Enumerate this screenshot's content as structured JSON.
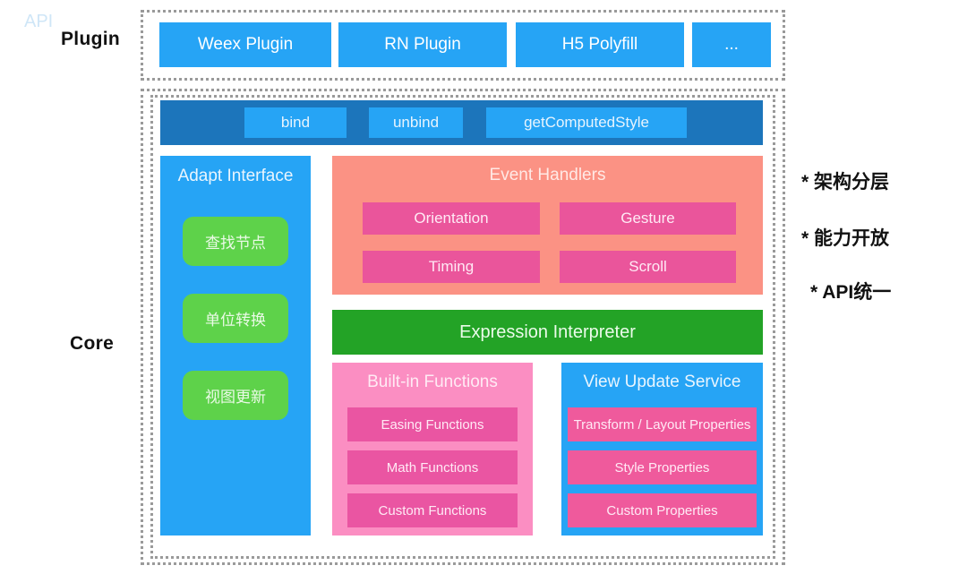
{
  "layers": {
    "plugin_label": "Plugin",
    "core_label": "Core"
  },
  "plugin_row": {
    "items": [
      {
        "label": "Weex Plugin"
      },
      {
        "label": "RN Plugin"
      },
      {
        "label": "H5 Polyfill"
      },
      {
        "label": "..."
      }
    ]
  },
  "api_bar": {
    "title": "API",
    "buttons": [
      {
        "label": "bind"
      },
      {
        "label": "unbind"
      },
      {
        "label": "getComputedStyle"
      }
    ]
  },
  "adapt_interface": {
    "title": "Adapt Interface",
    "items": [
      {
        "label": "查找节点"
      },
      {
        "label": "单位转换"
      },
      {
        "label": "视图更新"
      }
    ]
  },
  "event_handlers": {
    "title": "Event Handlers",
    "items": [
      {
        "label": "Orientation"
      },
      {
        "label": "Gesture"
      },
      {
        "label": "Timing"
      },
      {
        "label": "Scroll"
      }
    ]
  },
  "expression_interpreter": {
    "title": "Expression Interpreter"
  },
  "builtin_functions": {
    "title": "Built-in Functions",
    "items": [
      {
        "label": "Easing Functions"
      },
      {
        "label": "Math Functions"
      },
      {
        "label": "Custom Functions"
      }
    ]
  },
  "view_update_service": {
    "title": "View Update Service",
    "items": [
      {
        "label": "Transform / Layout Properties"
      },
      {
        "label": "Style Properties"
      },
      {
        "label": "Custom Properties"
      }
    ]
  },
  "notes": [
    {
      "text": "* 架构分层"
    },
    {
      "text": "* 能力开放"
    },
    {
      "text": "* API统一"
    }
  ],
  "colors": {
    "plugin_blue": "#26a4f5",
    "api_bar_blue": "#1c75bb",
    "green_button": "#5ed24a",
    "salmon": "#fb9284",
    "magenta": "#ea559b",
    "expression_green": "#23a326",
    "pink_panel": "#fb8ec2",
    "pink_button": "#ea55a2",
    "vus_pink": "#ef5a9c",
    "dotted_border": "#9a9a9a"
  }
}
